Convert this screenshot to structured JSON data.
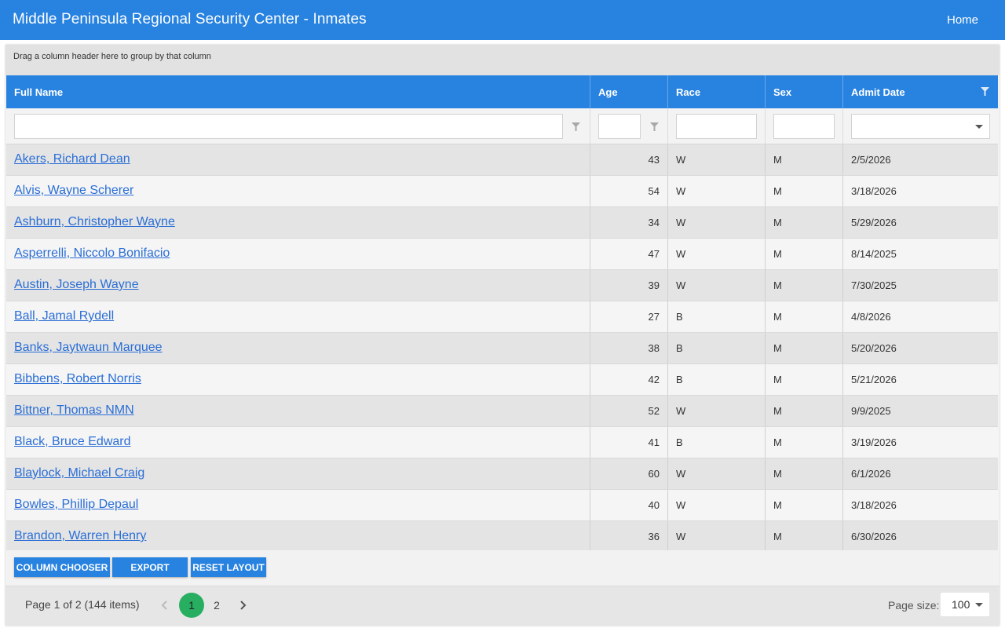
{
  "header": {
    "title": "Middle Peninsula Regional Security Center - Inmates",
    "home_label": "Home"
  },
  "grid": {
    "group_panel_text": "Drag a column header here to group by that column",
    "columns": [
      "Full Name",
      "Age",
      "Race",
      "Sex",
      "Admit Date"
    ],
    "rows": [
      {
        "name": "Akers, Richard Dean",
        "age": "43",
        "race": "W",
        "sex": "M",
        "admit": "2/5/2026"
      },
      {
        "name": "Alvis, Wayne Scherer",
        "age": "54",
        "race": "W",
        "sex": "M",
        "admit": "3/18/2026"
      },
      {
        "name": "Ashburn, Christopher Wayne",
        "age": "34",
        "race": "W",
        "sex": "M",
        "admit": "5/29/2026"
      },
      {
        "name": "Asperrelli, Niccolo Bonifacio",
        "age": "47",
        "race": "W",
        "sex": "M",
        "admit": "8/14/2025"
      },
      {
        "name": "Austin, Joseph Wayne",
        "age": "39",
        "race": "W",
        "sex": "M",
        "admit": "7/30/2025"
      },
      {
        "name": "Ball, Jamal Rydell",
        "age": "27",
        "race": "B",
        "sex": "M",
        "admit": "4/8/2026"
      },
      {
        "name": "Banks, Jaytwaun Marquee",
        "age": "38",
        "race": "B",
        "sex": "M",
        "admit": "5/20/2026"
      },
      {
        "name": "Bibbens, Robert Norris",
        "age": "42",
        "race": "B",
        "sex": "M",
        "admit": "5/21/2026"
      },
      {
        "name": "Bittner, Thomas NMN",
        "age": "52",
        "race": "W",
        "sex": "M",
        "admit": "9/9/2025"
      },
      {
        "name": "Black, Bruce Edward",
        "age": "41",
        "race": "B",
        "sex": "M",
        "admit": "3/19/2026"
      },
      {
        "name": "Blaylock, Michael Craig",
        "age": "60",
        "race": "W",
        "sex": "M",
        "admit": "6/1/2026"
      },
      {
        "name": "Bowles, Phillip Depaul",
        "age": "40",
        "race": "W",
        "sex": "M",
        "admit": "3/18/2026"
      },
      {
        "name": "Brandon, Warren Henry",
        "age": "36",
        "race": "W",
        "sex": "M",
        "admit": "6/30/2026"
      }
    ]
  },
  "toolbar": {
    "column_chooser": "COLUMN CHOOSER",
    "export": "EXPORT",
    "reset_layout": "RESET LAYOUT"
  },
  "pager": {
    "info": "Page 1 of 2 (144 items)",
    "pages": [
      "1",
      "2"
    ],
    "current_page": "1",
    "page_size_label": "Page size:",
    "page_size_value": "100"
  },
  "colors": {
    "accent": "#2782e0",
    "active_page": "#27ae60",
    "link": "#2a6ed6"
  }
}
